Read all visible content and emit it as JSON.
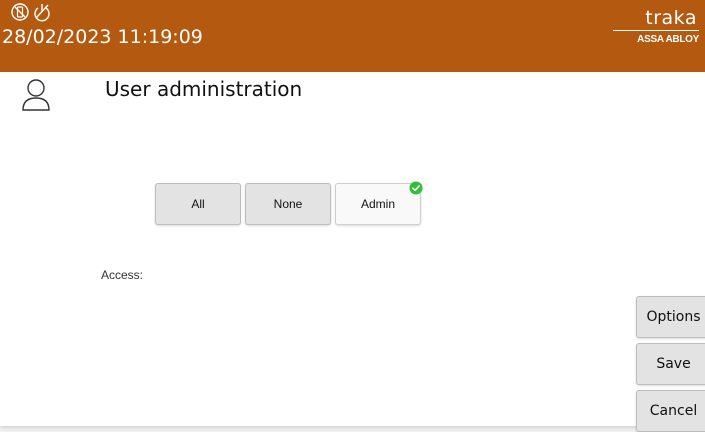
{
  "header": {
    "datetime": "28/02/2023 11:19:09",
    "status_icons": [
      "no-device-icon",
      "no-power-icon"
    ],
    "logo": {
      "word": "traka",
      "subtitle": "ASSA ABLOY"
    }
  },
  "page": {
    "title": "User administration",
    "icon": "user-icon"
  },
  "role_selector": {
    "buttons": [
      {
        "label": "All",
        "selected": false
      },
      {
        "label": "None",
        "selected": false
      },
      {
        "label": "Admin",
        "selected": true
      }
    ]
  },
  "access": {
    "label": "Access:"
  },
  "side_actions": {
    "options_label": "Options",
    "save_label": "Save",
    "cancel_label": "Cancel"
  },
  "colors": {
    "header_bg": "#b45a10",
    "selected_check": "#2fbf3a"
  }
}
